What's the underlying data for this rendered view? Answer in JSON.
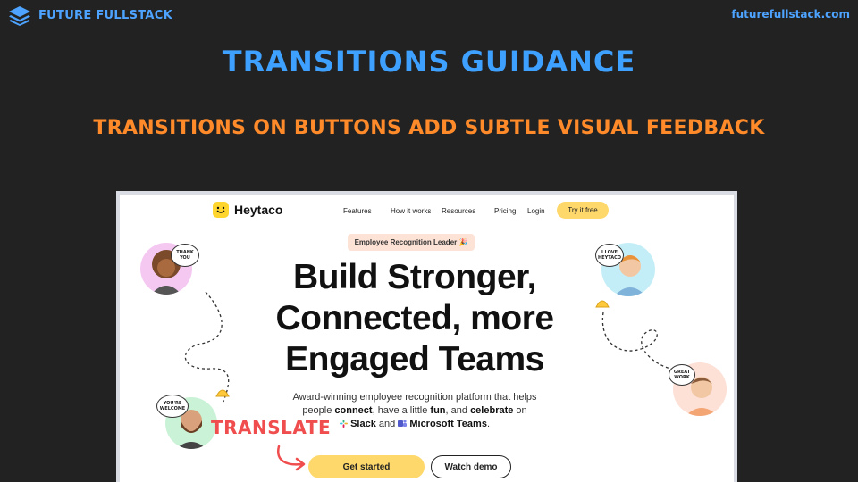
{
  "brand": {
    "name": "FUTURE FULLSTACK",
    "url": "futurefullstack.com"
  },
  "slide": {
    "title": "TRANSITIONS GUIDANCE",
    "subtitle": "TRANSITIONS ON BUTTONS ADD SUBTLE VISUAL FEEDBACK",
    "annotation": "TRANSLATE"
  },
  "screenshot": {
    "logo": "Heytaco",
    "nav": [
      "Features",
      "How it works",
      "Resources",
      "Pricing",
      "Login"
    ],
    "cta_nav": "Try it free",
    "badge": "Employee Recognition Leader 🎉",
    "headline": [
      "Build Stronger,",
      "Connected, more",
      "Engaged Teams"
    ],
    "description": {
      "line1": "Award-winning employee recognition platform that helps",
      "line2_a": "people ",
      "line2_b": "connect",
      "line2_c": ", have a little ",
      "line2_d": "fun",
      "line2_e": ", and ",
      "line2_f": "celebrate",
      "line2_g": " on",
      "line3_a": "Slack",
      "line3_b": " and ",
      "line3_c": "Microsoft Teams",
      "line3_d": "."
    },
    "buttons": {
      "primary": "Get started",
      "secondary": "Watch demo"
    },
    "bubbles": {
      "thank_you": [
        "THANK",
        "YOU"
      ],
      "love": [
        "I LOVE",
        "HEYTACO"
      ],
      "great": [
        "GREAT",
        "WORK"
      ],
      "welcome": [
        "YOU'RE",
        "WELCOME"
      ]
    }
  },
  "colors": {
    "background": "#222222",
    "brand_blue": "#4da3ff",
    "title_blue": "#3ea0ff",
    "subtitle_orange": "#ff8a2a",
    "annotation_red": "#f04e4e",
    "cta_yellow": "#ffd86b"
  }
}
